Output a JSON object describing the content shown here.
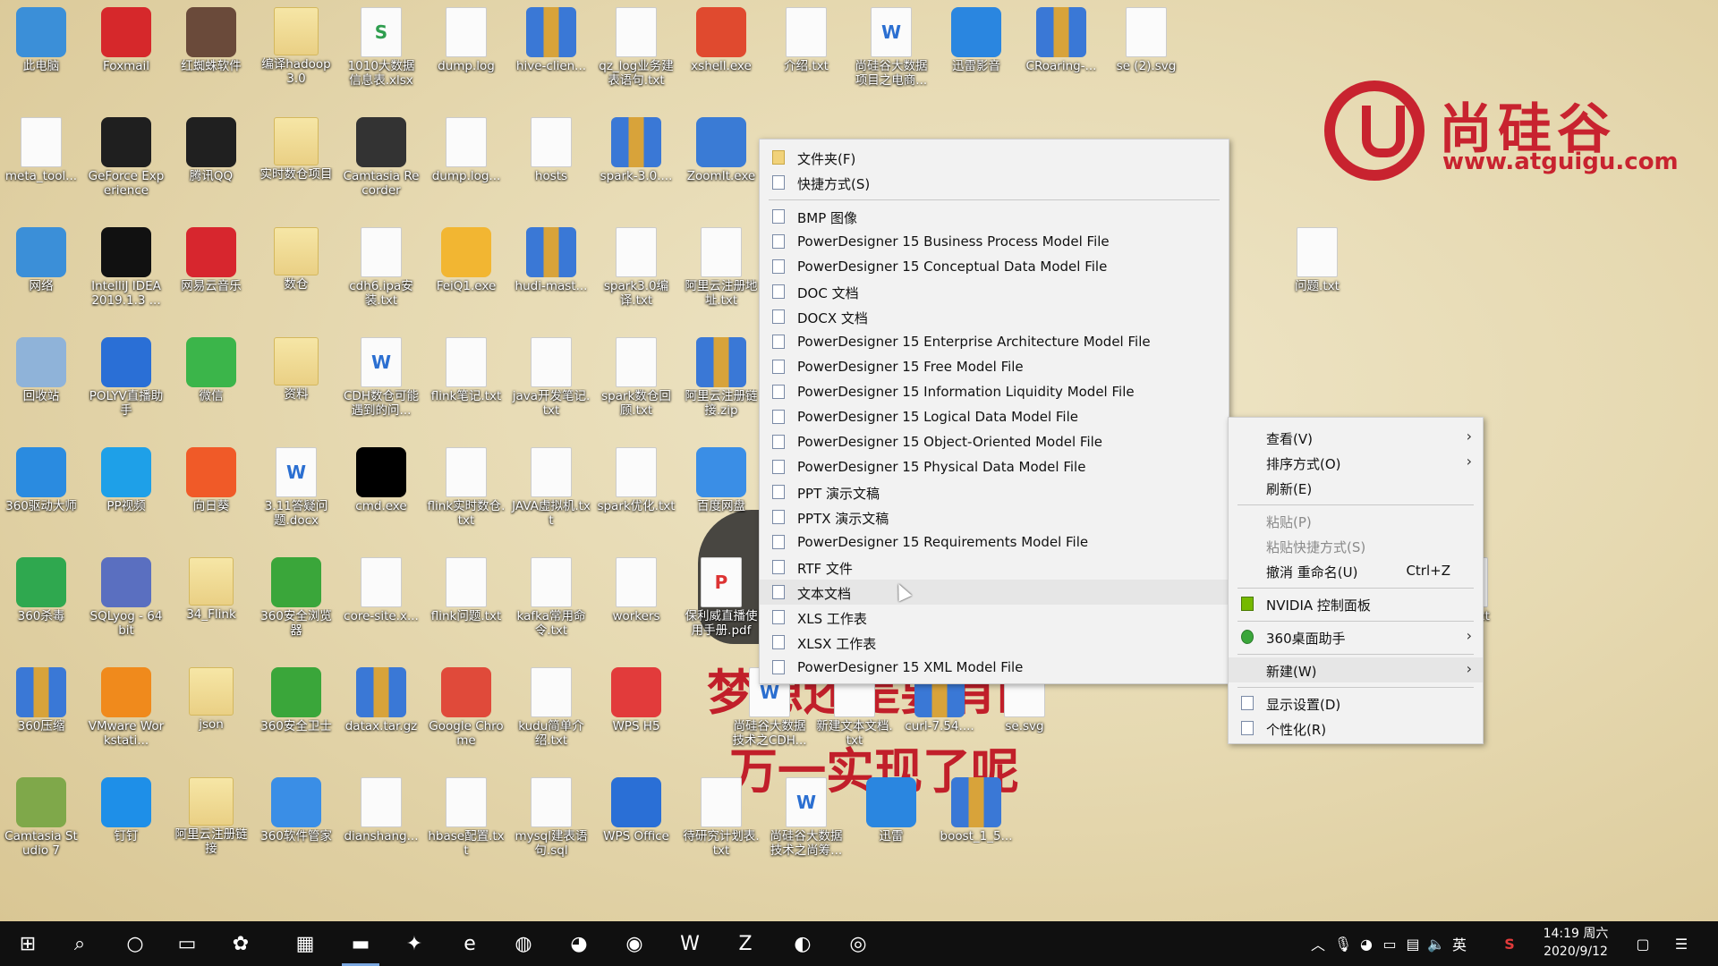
{
  "colors": {
    "accent": "#c8232f",
    "taskbar": "#101010",
    "menu_bg": "#f2f2f2",
    "highlight": "#e6e6e6"
  },
  "watermark": {
    "brand": "尚硅谷",
    "url": "www.atguigu.com",
    "slogan_line1": "梦想还是要有的",
    "slogan_line2": "万一实现了呢"
  },
  "desktop_icons": [
    {
      "label": "此电脑",
      "icon": "computer-icon",
      "c": "#3b8fd8"
    },
    {
      "label": "Foxmail",
      "icon": "foxmail-icon",
      "c": "#d6282b"
    },
    {
      "label": "红蜘蛛软件",
      "icon": "person-icon",
      "c": "#6a4a3a"
    },
    {
      "label": "编译hadoop3.0",
      "icon": "folder-icon",
      "k": "folder"
    },
    {
      "label": "1010大数据信息表.xlsx",
      "icon": "excel-icon",
      "k": "doc",
      "c": "#2f9e4f"
    },
    {
      "label": "dump.log",
      "icon": "file-icon",
      "k": "doc"
    },
    {
      "label": "hive-clien...",
      "icon": "archive-icon",
      "k": "rar"
    },
    {
      "label": "qz_log业务建表语句.txt",
      "icon": "file-icon",
      "k": "doc"
    },
    {
      "label": "xshell.exe",
      "icon": "xshell-icon",
      "c": "#e04a2f"
    },
    {
      "label": "介绍.txt",
      "icon": "file-icon",
      "k": "doc"
    },
    {
      "label": "尚硅谷大数据项目之电商...",
      "icon": "word-icon",
      "k": "doc"
    },
    {
      "label": "迅雷影音",
      "icon": "player-icon",
      "c": "#2a86e0"
    },
    {
      "label": "CRoaring-...",
      "icon": "archive-icon",
      "k": "rar"
    },
    {
      "label": "se (2).svg",
      "icon": "svg-file-icon",
      "k": "doc"
    },
    {
      "label": "meta_tool...",
      "icon": "file-icon",
      "k": "doc"
    },
    {
      "label": "GeForce Experience",
      "icon": "nvidia-icon",
      "c": "#1f1f1f"
    },
    {
      "label": "腾讯QQ",
      "icon": "qq-icon",
      "c": "#202020"
    },
    {
      "label": "实时数仓项目",
      "icon": "folder-icon",
      "k": "folder"
    },
    {
      "label": "Camtasia Recorder",
      "icon": "camera-icon",
      "c": "#333"
    },
    {
      "label": "dump.log...",
      "icon": "file-icon",
      "k": "doc"
    },
    {
      "label": "hosts",
      "icon": "file-icon",
      "k": "doc"
    },
    {
      "label": "spark-3.0....",
      "icon": "archive-icon",
      "k": "rar"
    },
    {
      "label": "ZoomIt.exe",
      "icon": "magnifier-icon",
      "c": "#3a7bd5"
    },
    {
      "label": "网络",
      "icon": "network-icon",
      "c": "#3b8fd8"
    },
    {
      "label": "IntelliJ IDEA 2019.1.3 ...",
      "icon": "intellij-icon",
      "c": "#111"
    },
    {
      "label": "网易云音乐",
      "icon": "netease-music-icon",
      "c": "#d7262e"
    },
    {
      "label": "数仓",
      "icon": "folder-icon",
      "k": "folder"
    },
    {
      "label": "cdh6.ipa安装.txt",
      "icon": "file-icon",
      "k": "doc"
    },
    {
      "label": "FeiQ1.exe",
      "icon": "feiq-icon",
      "c": "#f2b632"
    },
    {
      "label": "hudi-mast...",
      "icon": "archive-icon",
      "k": "rar"
    },
    {
      "label": "spark3.0编译.txt",
      "icon": "file-icon",
      "k": "doc"
    },
    {
      "label": "阿里云注册地址.txt",
      "icon": "file-icon",
      "k": "doc"
    },
    {
      "label": "回收站",
      "icon": "recycle-bin-icon",
      "c": "#8fb3d9"
    },
    {
      "label": "POLYV直播助手",
      "icon": "polyv-icon",
      "c": "#2a6fd6"
    },
    {
      "label": "微信",
      "icon": "wechat-icon",
      "c": "#3bb54a"
    },
    {
      "label": "资料",
      "icon": "folder-icon",
      "k": "folder"
    },
    {
      "label": "CDH数仓可能遇到的问...",
      "icon": "word-icon",
      "k": "doc"
    },
    {
      "label": "flink笔记.txt",
      "icon": "file-icon",
      "k": "doc"
    },
    {
      "label": "java开发笔记.txt",
      "icon": "file-icon",
      "k": "doc"
    },
    {
      "label": "spark数仓回顾.txt",
      "icon": "file-icon",
      "k": "doc"
    },
    {
      "label": "阿里云注册链接.zip",
      "icon": "archive-icon",
      "k": "rar"
    },
    {
      "label": "360驱动大师",
      "icon": "gear-icon",
      "c": "#2a8be0"
    },
    {
      "label": "PP视频",
      "icon": "pp-video-icon",
      "c": "#1ea0e8"
    },
    {
      "label": "向日葵",
      "icon": "sunflower-icon",
      "c": "#f05a28"
    },
    {
      "label": "3.11答疑问题.docx",
      "icon": "word-icon",
      "k": "doc"
    },
    {
      "label": "cmd.exe",
      "icon": "terminal-icon",
      "c": "#000"
    },
    {
      "label": "flink实时数仓.txt",
      "icon": "file-icon",
      "k": "doc"
    },
    {
      "label": "JAVA虚拟机.txt",
      "icon": "file-icon",
      "k": "doc"
    },
    {
      "label": "spark优化.txt",
      "icon": "file-icon",
      "k": "doc"
    },
    {
      "label": "百度网盘",
      "icon": "baidu-cloud-icon",
      "c": "#3a8ee6"
    },
    {
      "label": "360杀毒",
      "icon": "shield-icon",
      "c": "#2fa84f"
    },
    {
      "label": "SQLyog - 64 bit",
      "icon": "dolphin-icon",
      "c": "#5a6fc0"
    },
    {
      "label": "34_Flink",
      "icon": "folder-icon",
      "k": "folder"
    },
    {
      "label": "360安全浏览器",
      "icon": "browser-icon",
      "c": "#3aa63a"
    },
    {
      "label": "core-site.x...",
      "icon": "xml-file-icon",
      "k": "doc"
    },
    {
      "label": "flink问题.txt",
      "icon": "file-icon",
      "k": "doc"
    },
    {
      "label": "kafka常用命令.txt",
      "icon": "file-icon",
      "k": "doc"
    },
    {
      "label": "workers",
      "icon": "file-icon",
      "k": "doc"
    },
    {
      "label": "保利威直播使用手册.pdf",
      "icon": "pdf-icon",
      "k": "doc",
      "c": "#d33"
    },
    {
      "label": "360压缩",
      "icon": "archive-icon",
      "k": "rar"
    },
    {
      "label": "VMware Workstati...",
      "icon": "vmware-icon",
      "c": "#f08a1c"
    },
    {
      "label": "json",
      "icon": "folder-icon",
      "k": "folder"
    },
    {
      "label": "360安全卫士",
      "icon": "plus-icon",
      "c": "#3aa63a"
    },
    {
      "label": "datax.tar.gz",
      "icon": "archive-icon",
      "k": "rar"
    },
    {
      "label": "Google Chrome",
      "icon": "chrome-icon",
      "c": "#e04a3a"
    },
    {
      "label": "kudu简单介绍.txt",
      "icon": "file-icon",
      "k": "doc"
    },
    {
      "label": "WPS H5",
      "icon": "wps-h5-icon",
      "c": "#e23b3b"
    },
    {
      "label": "Camtasia Studio 7",
      "icon": "camtasia-icon",
      "c": "#7fa84a"
    },
    {
      "label": "钉钉",
      "icon": "dingtalk-icon",
      "c": "#1e8fe8"
    },
    {
      "label": "阿里云注册链接",
      "icon": "folder-icon",
      "k": "folder"
    },
    {
      "label": "360软件管家",
      "icon": "app-store-icon",
      "c": "#3a8ee6"
    },
    {
      "label": "dianshang...",
      "icon": "database-icon",
      "k": "doc"
    },
    {
      "label": "hbase配置.txt",
      "icon": "file-icon",
      "k": "doc"
    },
    {
      "label": "mysql建表语句.sql",
      "icon": "file-icon",
      "k": "doc"
    },
    {
      "label": "WPS Office",
      "icon": "wps-icon",
      "c": "#2a6fd6"
    },
    {
      "label": "待研究计划表.txt",
      "icon": "file-icon",
      "k": "doc"
    },
    {
      "label": "尚硅谷大数据技术之尚筹...",
      "icon": "word-icon",
      "k": "doc"
    },
    {
      "label": "迅雷",
      "icon": "thunder-icon",
      "c": "#2a86e0"
    },
    {
      "label": "boost_1_5...",
      "icon": "archive-icon",
      "k": "rar"
    },
    {
      "label": "问题.txt",
      "icon": "file-icon",
      "k": "doc"
    },
    {
      "label": "问题.txt",
      "icon": "file-icon",
      "k": "doc"
    },
    {
      "label": "尚硅谷大数据技术之CDH...",
      "icon": "word-icon",
      "k": "doc"
    },
    {
      "label": "新建文本文档.txt",
      "icon": "file-icon",
      "k": "doc"
    },
    {
      "label": "curl-7.54....",
      "icon": "archive-icon",
      "k": "rar"
    },
    {
      "label": "se.svg",
      "icon": "svg-file-icon",
      "k": "doc"
    }
  ],
  "new_submenu": {
    "items": [
      {
        "label": "文件夹(F)",
        "icon": "folder-icon"
      },
      {
        "label": "快捷方式(S)",
        "icon": "shortcut-icon"
      },
      {
        "sep": true
      },
      {
        "label": "BMP 图像",
        "icon": "bmp-icon"
      },
      {
        "label": "PowerDesigner 15 Business Process Model File",
        "icon": "powerdesigner-icon"
      },
      {
        "label": "PowerDesigner 15 Conceptual Data Model File",
        "icon": "powerdesigner-icon"
      },
      {
        "label": "DOC 文档",
        "icon": "doc-icon"
      },
      {
        "label": "DOCX 文档",
        "icon": "docx-icon"
      },
      {
        "label": "PowerDesigner 15 Enterprise Architecture Model File",
        "icon": "powerdesigner-icon"
      },
      {
        "label": "PowerDesigner 15 Free Model File",
        "icon": "powerdesigner-icon"
      },
      {
        "label": "PowerDesigner 15 Information Liquidity Model File",
        "icon": "powerdesigner-icon"
      },
      {
        "label": "PowerDesigner 15 Logical Data Model File",
        "icon": "powerdesigner-icon"
      },
      {
        "label": "PowerDesigner 15 Object-Oriented Model File",
        "icon": "powerdesigner-icon"
      },
      {
        "label": "PowerDesigner 15 Physical Data Model File",
        "icon": "powerdesigner-icon"
      },
      {
        "label": "PPT 演示文稿",
        "icon": "ppt-icon"
      },
      {
        "label": "PPTX 演示文稿",
        "icon": "pptx-icon"
      },
      {
        "label": "PowerDesigner 15 Requirements Model File",
        "icon": "powerdesigner-icon"
      },
      {
        "label": "RTF 文件",
        "icon": "rtf-icon"
      },
      {
        "label": "文本文档",
        "icon": "text-document-icon",
        "highlight": true
      },
      {
        "label": "XLS 工作表",
        "icon": "xls-icon"
      },
      {
        "label": "XLSX 工作表",
        "icon": "xlsx-icon"
      },
      {
        "label": "PowerDesigner 15 XML Model File",
        "icon": "powerdesigner-icon"
      }
    ]
  },
  "context_menu": {
    "items": [
      {
        "label": "查看(V)",
        "arrow": true
      },
      {
        "label": "排序方式(O)",
        "arrow": true
      },
      {
        "label": "刷新(E)"
      },
      {
        "sep": true
      },
      {
        "label": "粘贴(P)",
        "disabled": true
      },
      {
        "label": "粘贴快捷方式(S)",
        "disabled": true
      },
      {
        "label": "撤消 重命名(U)",
        "accel": "Ctrl+Z"
      },
      {
        "sep": true
      },
      {
        "label": "NVIDIA 控制面板",
        "icon": "nvidia-icon"
      },
      {
        "sep": true
      },
      {
        "label": "360桌面助手",
        "icon": "plus-icon",
        "arrow": true
      },
      {
        "sep": true
      },
      {
        "label": "新建(W)",
        "arrow": true,
        "highlight": true
      },
      {
        "sep": true
      },
      {
        "label": "显示设置(D)",
        "icon": "display-icon"
      },
      {
        "label": "个性化(R)",
        "icon": "personalize-icon"
      }
    ]
  },
  "taskbar": {
    "apps": [
      {
        "name": "start-button",
        "glyph": "⊞"
      },
      {
        "name": "search-icon",
        "glyph": "⌕"
      },
      {
        "name": "cortana-icon",
        "glyph": "○"
      },
      {
        "name": "task-view-icon",
        "glyph": "▭"
      },
      {
        "name": "taskbar-app-1",
        "glyph": "✿"
      },
      {
        "name": "store-icon",
        "glyph": "▦"
      },
      {
        "name": "file-explorer-icon",
        "glyph": "▬",
        "active": true
      },
      {
        "name": "taskbar-app-2",
        "glyph": "✦"
      },
      {
        "name": "edge-icon",
        "glyph": "e"
      },
      {
        "name": "taskbar-app-3",
        "glyph": "◍"
      },
      {
        "name": "feiq-icon",
        "glyph": "◕"
      },
      {
        "name": "chrome-icon",
        "glyph": "◉"
      },
      {
        "name": "wps-icon",
        "glyph": "W"
      },
      {
        "name": "filezilla-icon",
        "glyph": "Z"
      },
      {
        "name": "xshell-icon",
        "glyph": "◐"
      },
      {
        "name": "obs-icon",
        "glyph": "◎"
      }
    ],
    "tray": {
      "ime": "英",
      "time": "14:19 周六",
      "date": "2020/9/12"
    }
  }
}
